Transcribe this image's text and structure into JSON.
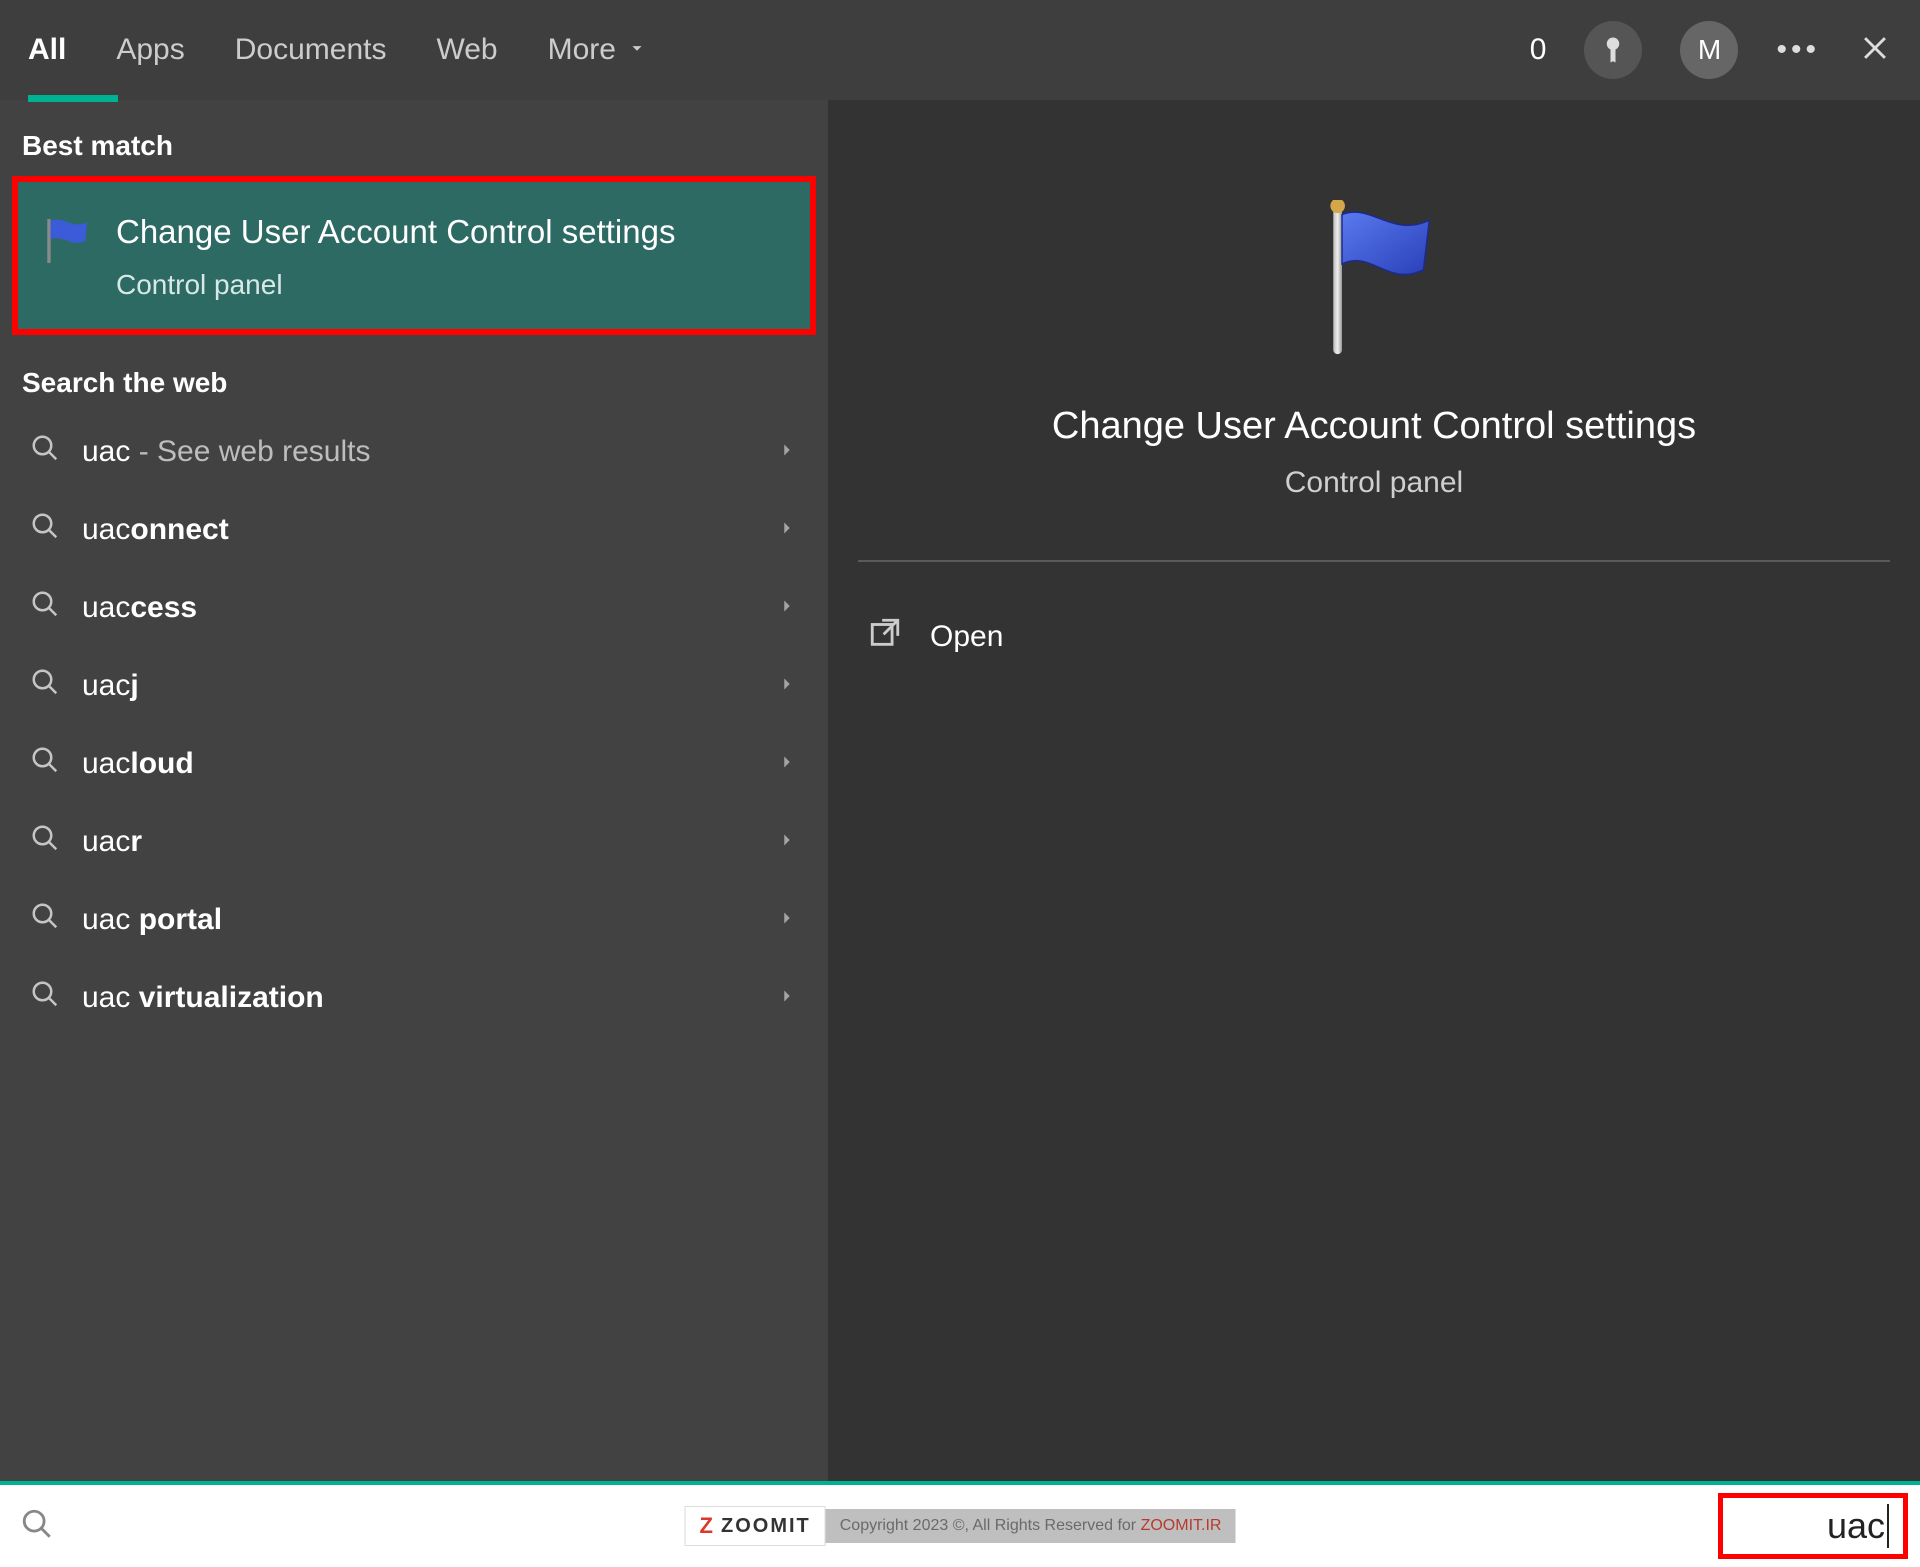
{
  "topbar": {
    "tabs": [
      "All",
      "Apps",
      "Documents",
      "Web",
      "More"
    ],
    "active_tab_index": 0,
    "rewards_count": "0",
    "avatar_initial": "M"
  },
  "sections": {
    "best_match_header": "Best match",
    "search_web_header": "Search the web"
  },
  "best_match": {
    "title": "Change User Account Control settings",
    "subtitle": "Control panel"
  },
  "web_results": [
    {
      "prefix": "uac",
      "bold": "",
      "extra": " - See web results"
    },
    {
      "prefix": "uac",
      "bold": "onnect",
      "extra": ""
    },
    {
      "prefix": "uac",
      "bold": "cess",
      "extra": ""
    },
    {
      "prefix": "uac",
      "bold": "j",
      "extra": ""
    },
    {
      "prefix": "uac",
      "bold": "loud",
      "extra": ""
    },
    {
      "prefix": "uac",
      "bold": "r",
      "extra": ""
    },
    {
      "prefix": "uac ",
      "bold": "portal",
      "extra": ""
    },
    {
      "prefix": "uac ",
      "bold": "virtualization",
      "extra": ""
    }
  ],
  "preview": {
    "title": "Change User Account Control settings",
    "subtitle": "Control panel",
    "actions": {
      "open": "Open"
    }
  },
  "searchbar": {
    "typed": "uac"
  },
  "watermark": {
    "logo": "ZOOMIT",
    "copyright_prefix": "Copyright 2023 ©, All Rights Reserved for ",
    "copyright_brand": "ZOOMIT.IR"
  }
}
